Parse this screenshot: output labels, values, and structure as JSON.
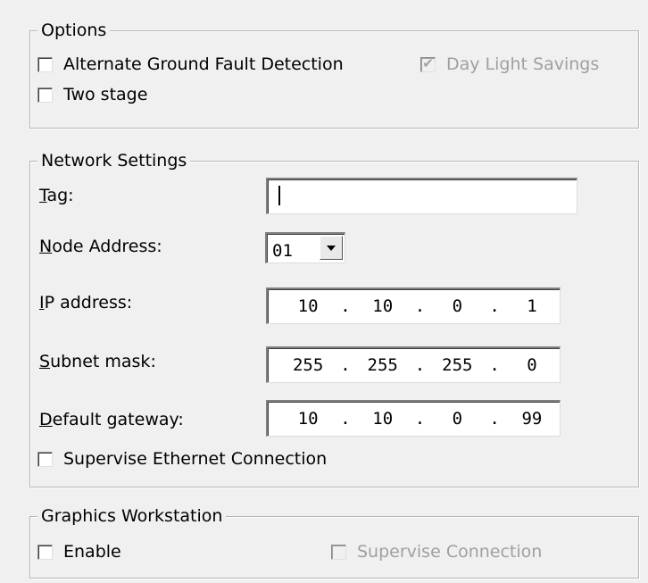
{
  "options": {
    "title": "Options",
    "alternate_ground_fault": {
      "label": "Alternate Ground Fault Detection",
      "checked": false
    },
    "day_light_savings": {
      "label": "Day Light Savings",
      "checked": true,
      "disabled": true
    },
    "two_stage": {
      "label": "Two stage",
      "checked": false
    }
  },
  "network": {
    "title": "Network Settings",
    "tag": {
      "label_mnemonic": "T",
      "label_rest": "ag:",
      "value": ""
    },
    "node_address": {
      "label_mnemonic": "N",
      "label_rest": "ode Address:",
      "value": "01"
    },
    "ip_address": {
      "label_mnemonic": "I",
      "label_rest": "P address:",
      "octets": [
        "10",
        "10",
        "0",
        "1"
      ]
    },
    "subnet_mask": {
      "label_mnemonic": "S",
      "label_rest": "ubnet mask:",
      "octets": [
        "255",
        "255",
        "255",
        "0"
      ]
    },
    "default_gateway": {
      "label_mnemonic": "D",
      "label_rest": "efault gateway:",
      "octets": [
        "10",
        "10",
        "0",
        "99"
      ]
    },
    "supervise_ethernet": {
      "label": "Supervise Ethernet Connection",
      "checked": false
    },
    "dot": "."
  },
  "graphics": {
    "title": "Graphics Workstation",
    "enable": {
      "label": "Enable",
      "checked": false
    },
    "supervise_connection": {
      "label": "Supervise Connection",
      "checked": false,
      "disabled": true
    }
  }
}
